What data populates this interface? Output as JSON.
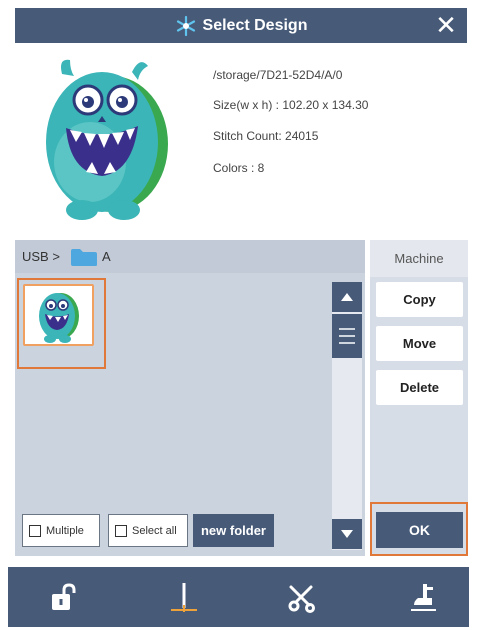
{
  "titlebar": {
    "title": "Select Design",
    "close_icon": "close-icon",
    "logo_icon": "snowflake-logo-icon"
  },
  "info": {
    "path": "/storage/7D21-52D4/A/0",
    "size": "Size(w x h) :  102.20 x 134.30",
    "stitch_count": "Stitch Count: 24015",
    "colors": "Colors    : 8"
  },
  "breadcrumb": {
    "root": "USB >",
    "folder_icon": "folder-icon",
    "folder_name": "A"
  },
  "toolbar": {
    "multiple_label": "Multiple",
    "select_all_label": "Select all",
    "new_folder_label": "new folder"
  },
  "side": {
    "machine_label": "Machine",
    "copy_label": "Copy",
    "move_label": "Move",
    "delete_label": "Delete",
    "ok_label": "OK"
  },
  "bottom_nav": {
    "icons": [
      "unlock-icon",
      "needle-icon",
      "scissors-icon",
      "presser-foot-icon"
    ]
  },
  "colors": {
    "bar": "#475a78",
    "highlight": "#e0783a",
    "panel": "#cbd3df"
  }
}
